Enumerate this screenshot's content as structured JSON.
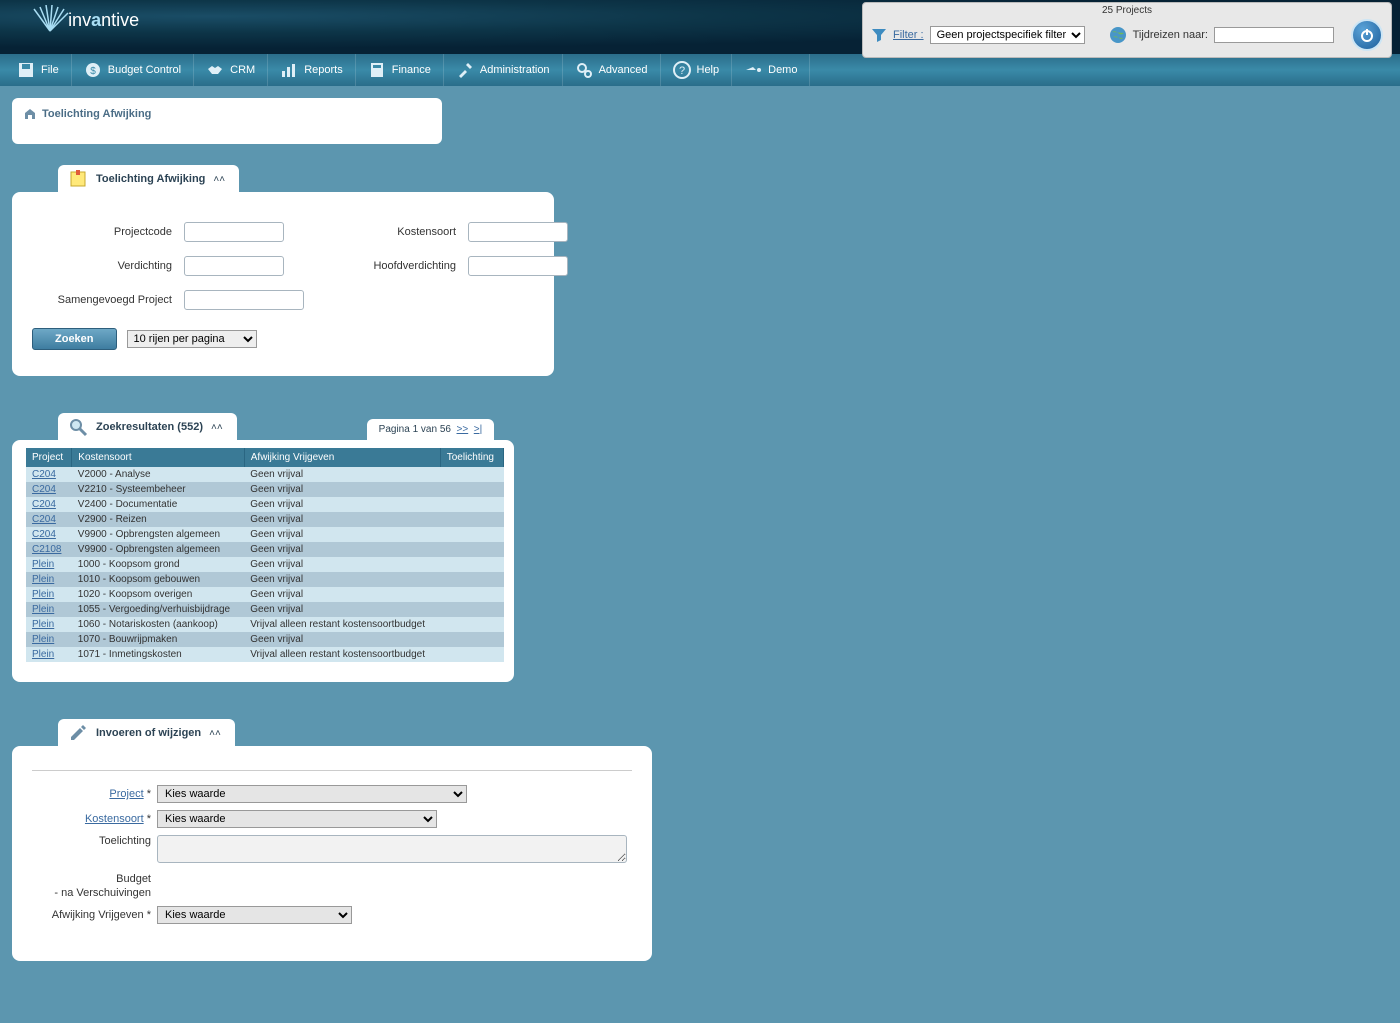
{
  "header": {
    "logo_text_prefix": "inv",
    "logo_text_mid": "a",
    "logo_text_suffix": "ntive",
    "projects_count": "25 Projects",
    "filter_label": "Filter :",
    "filter_selected": "Geen projectspecifiek filter",
    "time_label": "Tijdreizen naar:",
    "time_value": ""
  },
  "menu": [
    {
      "label": "File",
      "icon": "save-icon"
    },
    {
      "label": "Budget Control",
      "icon": "money-icon"
    },
    {
      "label": "CRM",
      "icon": "handshake-icon"
    },
    {
      "label": "Reports",
      "icon": "chart-icon"
    },
    {
      "label": "Finance",
      "icon": "calculator-icon"
    },
    {
      "label": "Administration",
      "icon": "tools-icon"
    },
    {
      "label": "Advanced",
      "icon": "gears-icon"
    },
    {
      "label": "Help",
      "icon": "help-icon"
    },
    {
      "label": "Demo",
      "icon": "demo-icon"
    }
  ],
  "breadcrumb": {
    "title": "Toelichting Afwijking"
  },
  "search_section": {
    "tab_label": "Toelichting Afwijking",
    "fields": {
      "projectcode": "Projectcode",
      "kostensoort": "Kostensoort",
      "verdichting": "Verdichting",
      "hoofdverdichting": "Hoofdverdichting",
      "samengevoegd": "Samengevoegd Project"
    },
    "button_label": "Zoeken",
    "rows_select": "10 rijen per pagina"
  },
  "results_section": {
    "tab_label": "Zoekresultaten (552)",
    "pagination": {
      "text": "Pagina 1 van 56",
      "next": ">>",
      "last": ">|"
    },
    "columns": [
      "Project",
      "Kostensoort",
      "Afwijking Vrijgeven",
      "Toelichting"
    ],
    "rows": [
      {
        "project": "C204",
        "kostensoort": "V2000 - Analyse",
        "afwijking": "Geen vrijval",
        "toelichting": ""
      },
      {
        "project": "C204",
        "kostensoort": "V2210 - Systeembeheer",
        "afwijking": "Geen vrijval",
        "toelichting": ""
      },
      {
        "project": "C204",
        "kostensoort": "V2400 - Documentatie",
        "afwijking": "Geen vrijval",
        "toelichting": ""
      },
      {
        "project": "C204",
        "kostensoort": "V2900 - Reizen",
        "afwijking": "Geen vrijval",
        "toelichting": ""
      },
      {
        "project": "C204",
        "kostensoort": "V9900 - Opbrengsten algemeen",
        "afwijking": "Geen vrijval",
        "toelichting": ""
      },
      {
        "project": "C2108",
        "kostensoort": "V9900 - Opbrengsten algemeen",
        "afwijking": "Geen vrijval",
        "toelichting": ""
      },
      {
        "project": "Plein",
        "kostensoort": "1000 - Koopsom grond",
        "afwijking": "Geen vrijval",
        "toelichting": ""
      },
      {
        "project": "Plein",
        "kostensoort": "1010 - Koopsom gebouwen",
        "afwijking": "Geen vrijval",
        "toelichting": ""
      },
      {
        "project": "Plein",
        "kostensoort": "1020 - Koopsom overigen",
        "afwijking": "Geen vrijval",
        "toelichting": ""
      },
      {
        "project": "Plein",
        "kostensoort": "1055 - Vergoeding/verhuisbijdrage",
        "afwijking": "Geen vrijval",
        "toelichting": ""
      },
      {
        "project": "Plein",
        "kostensoort": "1060 - Notariskosten (aankoop)",
        "afwijking": "Vrijval alleen restant kostensoortbudget",
        "toelichting": ""
      },
      {
        "project": "Plein",
        "kostensoort": "1070 - Bouwrijpmaken",
        "afwijking": "Geen vrijval",
        "toelichting": ""
      },
      {
        "project": "Plein",
        "kostensoort": "1071 - Inmetingskosten",
        "afwijking": "Vrijval alleen restant kostensoortbudget",
        "toelichting": ""
      }
    ]
  },
  "edit_section": {
    "tab_label": "Invoeren of wijzigen",
    "labels": {
      "project": "Project",
      "kostensoort": "Kostensoort",
      "toelichting": "Toelichting",
      "budget": "Budget",
      "budget_sub": "- na Verschuivingen",
      "afwijking": "Afwijking Vrijgeven"
    },
    "selects": {
      "project": "Kies waarde",
      "kostensoort": "Kies waarde",
      "afwijking": "Kies waarde"
    }
  }
}
